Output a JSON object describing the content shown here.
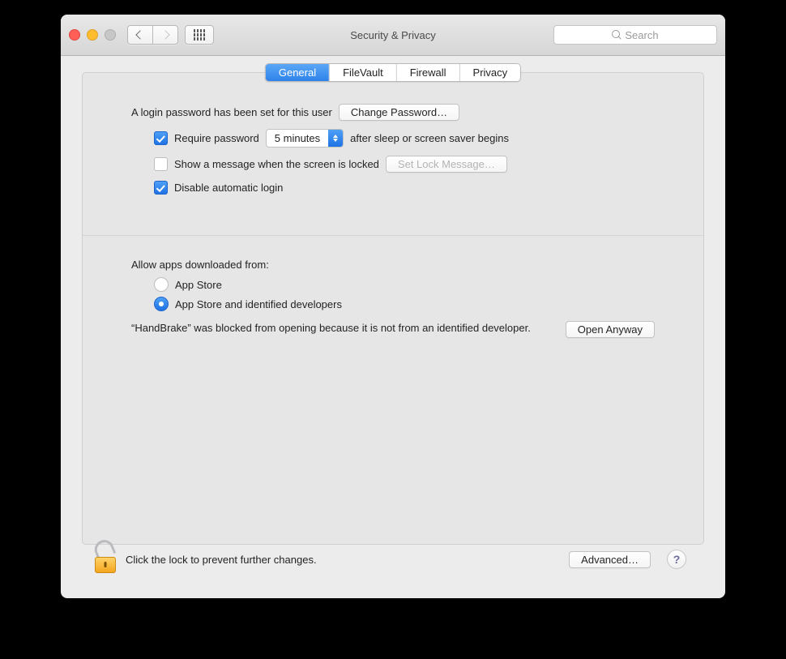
{
  "window": {
    "title": "Security & Privacy"
  },
  "toolbar": {
    "search_placeholder": "Search"
  },
  "tabs": [
    "General",
    "FileVault",
    "Firewall",
    "Privacy"
  ],
  "general": {
    "login_pw_msg": "A login password has been set for this user",
    "change_pw_btn": "Change Password…",
    "require_pw": {
      "checked": true,
      "prefix": "Require password",
      "delay_value": "5 minutes",
      "suffix": "after sleep or screen saver begins"
    },
    "lock_message": {
      "checked": false,
      "label": "Show a message when the screen is locked",
      "button": "Set Lock Message…"
    },
    "disable_auto_login": {
      "checked": true,
      "label": "Disable automatic login"
    },
    "allow_apps_heading": "Allow apps downloaded from:",
    "allow_apps_options": [
      "App Store",
      "App Store and identified developers"
    ],
    "allow_apps_selected": 1,
    "blocked_msg": "“HandBrake” was blocked from opening because it is not from an identified developer.",
    "open_anyway_btn": "Open Anyway"
  },
  "footer": {
    "lock_msg": "Click the lock to prevent further changes.",
    "advanced_btn": "Advanced…",
    "help": "?"
  }
}
